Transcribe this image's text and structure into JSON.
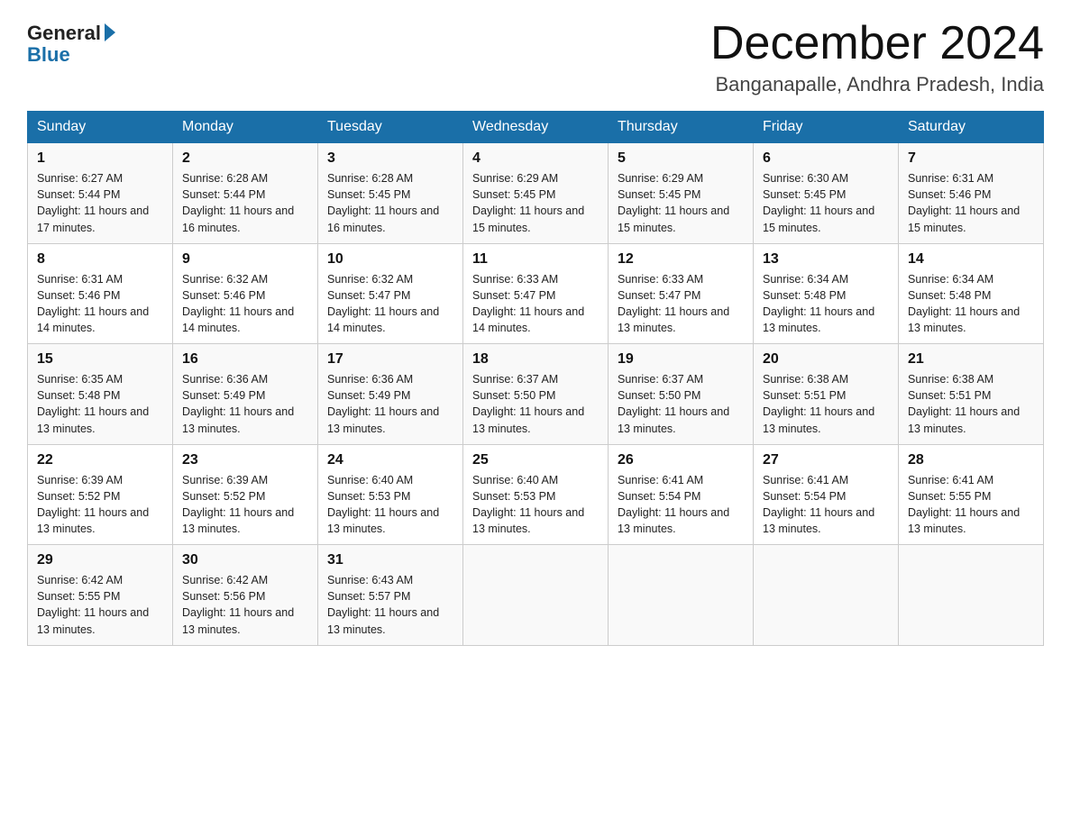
{
  "header": {
    "logo_general": "General",
    "logo_blue": "Blue",
    "month_title": "December 2024",
    "location": "Banganapalle, Andhra Pradesh, India"
  },
  "days_of_week": [
    "Sunday",
    "Monday",
    "Tuesday",
    "Wednesday",
    "Thursday",
    "Friday",
    "Saturday"
  ],
  "weeks": [
    [
      {
        "day": "1",
        "sunrise": "6:27 AM",
        "sunset": "5:44 PM",
        "daylight": "11 hours and 17 minutes."
      },
      {
        "day": "2",
        "sunrise": "6:28 AM",
        "sunset": "5:44 PM",
        "daylight": "11 hours and 16 minutes."
      },
      {
        "day": "3",
        "sunrise": "6:28 AM",
        "sunset": "5:45 PM",
        "daylight": "11 hours and 16 minutes."
      },
      {
        "day": "4",
        "sunrise": "6:29 AM",
        "sunset": "5:45 PM",
        "daylight": "11 hours and 15 minutes."
      },
      {
        "day": "5",
        "sunrise": "6:29 AM",
        "sunset": "5:45 PM",
        "daylight": "11 hours and 15 minutes."
      },
      {
        "day": "6",
        "sunrise": "6:30 AM",
        "sunset": "5:45 PM",
        "daylight": "11 hours and 15 minutes."
      },
      {
        "day": "7",
        "sunrise": "6:31 AM",
        "sunset": "5:46 PM",
        "daylight": "11 hours and 15 minutes."
      }
    ],
    [
      {
        "day": "8",
        "sunrise": "6:31 AM",
        "sunset": "5:46 PM",
        "daylight": "11 hours and 14 minutes."
      },
      {
        "day": "9",
        "sunrise": "6:32 AM",
        "sunset": "5:46 PM",
        "daylight": "11 hours and 14 minutes."
      },
      {
        "day": "10",
        "sunrise": "6:32 AM",
        "sunset": "5:47 PM",
        "daylight": "11 hours and 14 minutes."
      },
      {
        "day": "11",
        "sunrise": "6:33 AM",
        "sunset": "5:47 PM",
        "daylight": "11 hours and 14 minutes."
      },
      {
        "day": "12",
        "sunrise": "6:33 AM",
        "sunset": "5:47 PM",
        "daylight": "11 hours and 13 minutes."
      },
      {
        "day": "13",
        "sunrise": "6:34 AM",
        "sunset": "5:48 PM",
        "daylight": "11 hours and 13 minutes."
      },
      {
        "day": "14",
        "sunrise": "6:34 AM",
        "sunset": "5:48 PM",
        "daylight": "11 hours and 13 minutes."
      }
    ],
    [
      {
        "day": "15",
        "sunrise": "6:35 AM",
        "sunset": "5:48 PM",
        "daylight": "11 hours and 13 minutes."
      },
      {
        "day": "16",
        "sunrise": "6:36 AM",
        "sunset": "5:49 PM",
        "daylight": "11 hours and 13 minutes."
      },
      {
        "day": "17",
        "sunrise": "6:36 AM",
        "sunset": "5:49 PM",
        "daylight": "11 hours and 13 minutes."
      },
      {
        "day": "18",
        "sunrise": "6:37 AM",
        "sunset": "5:50 PM",
        "daylight": "11 hours and 13 minutes."
      },
      {
        "day": "19",
        "sunrise": "6:37 AM",
        "sunset": "5:50 PM",
        "daylight": "11 hours and 13 minutes."
      },
      {
        "day": "20",
        "sunrise": "6:38 AM",
        "sunset": "5:51 PM",
        "daylight": "11 hours and 13 minutes."
      },
      {
        "day": "21",
        "sunrise": "6:38 AM",
        "sunset": "5:51 PM",
        "daylight": "11 hours and 13 minutes."
      }
    ],
    [
      {
        "day": "22",
        "sunrise": "6:39 AM",
        "sunset": "5:52 PM",
        "daylight": "11 hours and 13 minutes."
      },
      {
        "day": "23",
        "sunrise": "6:39 AM",
        "sunset": "5:52 PM",
        "daylight": "11 hours and 13 minutes."
      },
      {
        "day": "24",
        "sunrise": "6:40 AM",
        "sunset": "5:53 PM",
        "daylight": "11 hours and 13 minutes."
      },
      {
        "day": "25",
        "sunrise": "6:40 AM",
        "sunset": "5:53 PM",
        "daylight": "11 hours and 13 minutes."
      },
      {
        "day": "26",
        "sunrise": "6:41 AM",
        "sunset": "5:54 PM",
        "daylight": "11 hours and 13 minutes."
      },
      {
        "day": "27",
        "sunrise": "6:41 AM",
        "sunset": "5:54 PM",
        "daylight": "11 hours and 13 minutes."
      },
      {
        "day": "28",
        "sunrise": "6:41 AM",
        "sunset": "5:55 PM",
        "daylight": "11 hours and 13 minutes."
      }
    ],
    [
      {
        "day": "29",
        "sunrise": "6:42 AM",
        "sunset": "5:55 PM",
        "daylight": "11 hours and 13 minutes."
      },
      {
        "day": "30",
        "sunrise": "6:42 AM",
        "sunset": "5:56 PM",
        "daylight": "11 hours and 13 minutes."
      },
      {
        "day": "31",
        "sunrise": "6:43 AM",
        "sunset": "5:57 PM",
        "daylight": "11 hours and 13 minutes."
      },
      null,
      null,
      null,
      null
    ]
  ]
}
